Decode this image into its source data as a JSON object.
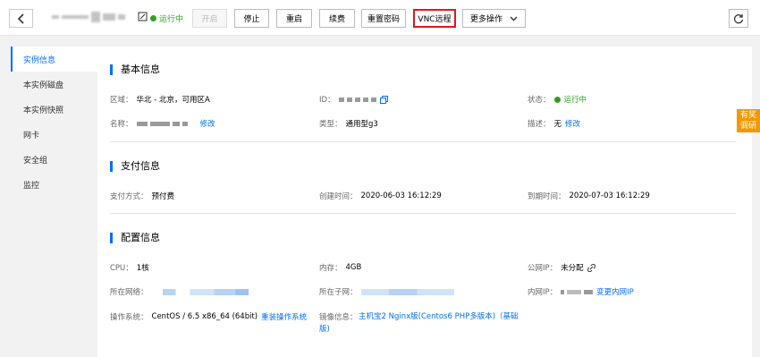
{
  "header": {
    "status": "运行中",
    "buttons": {
      "start": "开启",
      "stop": "停止",
      "restart": "重启",
      "renew": "续费",
      "reset_password": "重置密码",
      "vnc": "VNC远程",
      "more": "更多操作"
    }
  },
  "sidebar": {
    "items": [
      {
        "label": "实例信息",
        "active": true
      },
      {
        "label": "本实例磁盘"
      },
      {
        "label": "本实例快照"
      },
      {
        "label": "网卡"
      },
      {
        "label": "安全组"
      },
      {
        "label": "监控"
      }
    ]
  },
  "basic": {
    "title": "基本信息",
    "region_label": "区域：",
    "region_value": "华北 - 北京，可用区A",
    "id_label": "ID：",
    "status_label": "状态：",
    "status_value": "运行中",
    "name_label": "名称：",
    "name_edit": "修改",
    "type_label": "类型：",
    "type_value": "通用型g3",
    "desc_label": "描述：",
    "desc_value": "无",
    "desc_edit": "修改"
  },
  "payment": {
    "title": "支付信息",
    "method_label": "支付方式：",
    "method_value": "预付费",
    "created_label": "创建时间：",
    "created_value": "2020-06-03 16:12:29",
    "expire_label": "到期时间：",
    "expire_value": "2020-07-03 16:12:29"
  },
  "config": {
    "title": "配置信息",
    "cpu_label": "CPU：",
    "cpu_value": "1核",
    "mem_label": "内存：",
    "mem_value": "4GB",
    "public_ip_label": "公网IP：",
    "public_ip_value": "未分配",
    "network_label": "所在网络：",
    "subnet_label": "所在子网：",
    "private_ip_label": "内网IP：",
    "change_private_ip": "变更内网IP",
    "os_label": "操作系统：",
    "os_value": "CentOS / 6.5 x86_64 (64bit)",
    "reinstall": "重装操作系统",
    "image_label": "镜像信息：",
    "image_value_line1": "主机宝2 Nginx版(Centos6 PHP多版本)（基础",
    "image_value_line2": "版)"
  },
  "float": {
    "line1": "有奖",
    "line2": "调研"
  },
  "colors": {
    "accent": "#006eff",
    "running": "#2ea121",
    "highlight_border": "#e1171d",
    "reward": "#f39800"
  }
}
